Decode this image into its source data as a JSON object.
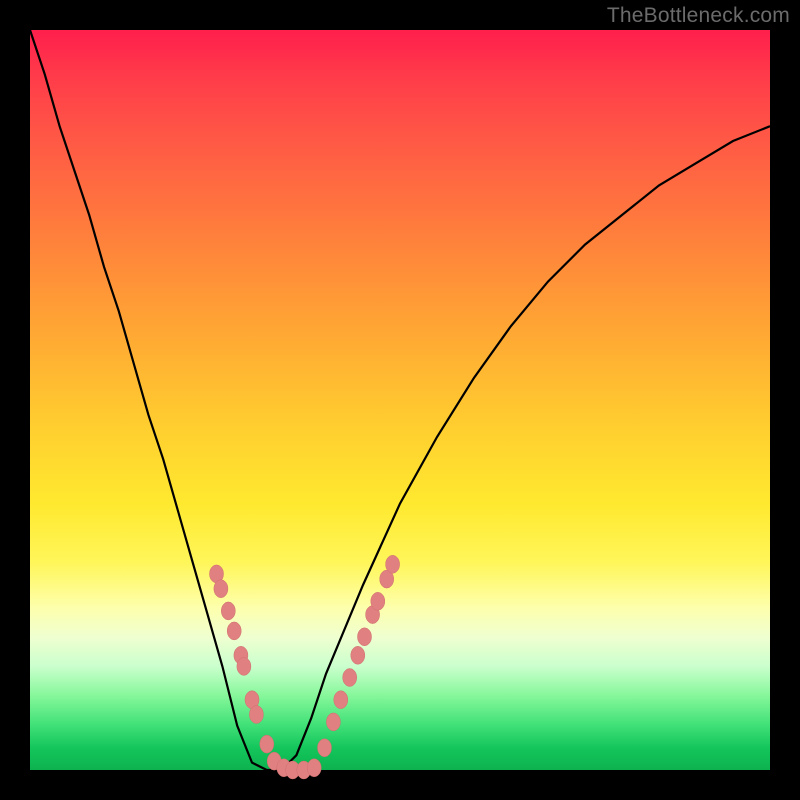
{
  "watermark_text": "TheBottleneck.com",
  "colors": {
    "frame": "#000000",
    "curve": "#000000",
    "marker_fill": "#e08080",
    "marker_stroke": "#d06f6f"
  },
  "chart_data": {
    "type": "line",
    "title": "",
    "xlabel": "",
    "ylabel": "",
    "x": [
      0.0,
      0.02,
      0.04,
      0.06,
      0.08,
      0.1,
      0.12,
      0.14,
      0.16,
      0.18,
      0.2,
      0.22,
      0.24,
      0.26,
      0.28,
      0.3,
      0.32,
      0.34,
      0.36,
      0.38,
      0.4,
      0.45,
      0.5,
      0.55,
      0.6,
      0.65,
      0.7,
      0.75,
      0.8,
      0.85,
      0.9,
      0.95,
      1.0
    ],
    "y": [
      1.0,
      0.94,
      0.87,
      0.81,
      0.75,
      0.68,
      0.62,
      0.55,
      0.48,
      0.42,
      0.35,
      0.28,
      0.21,
      0.14,
      0.06,
      0.01,
      0.0,
      0.0,
      0.02,
      0.07,
      0.13,
      0.25,
      0.36,
      0.45,
      0.53,
      0.6,
      0.66,
      0.71,
      0.75,
      0.79,
      0.82,
      0.85,
      0.87
    ],
    "xlim": [
      0,
      1
    ],
    "ylim": [
      0,
      1
    ],
    "annotations": [],
    "markers_left": [
      {
        "x": 0.252,
        "y": 0.265
      },
      {
        "x": 0.258,
        "y": 0.245
      },
      {
        "x": 0.268,
        "y": 0.215
      },
      {
        "x": 0.276,
        "y": 0.188
      },
      {
        "x": 0.285,
        "y": 0.155
      },
      {
        "x": 0.289,
        "y": 0.14
      },
      {
        "x": 0.3,
        "y": 0.095
      },
      {
        "x": 0.306,
        "y": 0.075
      },
      {
        "x": 0.32,
        "y": 0.035
      }
    ],
    "markers_bottom": [
      {
        "x": 0.33,
        "y": 0.012
      },
      {
        "x": 0.343,
        "y": 0.003
      },
      {
        "x": 0.355,
        "y": 0.0
      },
      {
        "x": 0.37,
        "y": 0.0
      },
      {
        "x": 0.384,
        "y": 0.003
      }
    ],
    "markers_right": [
      {
        "x": 0.398,
        "y": 0.03
      },
      {
        "x": 0.41,
        "y": 0.065
      },
      {
        "x": 0.42,
        "y": 0.095
      },
      {
        "x": 0.432,
        "y": 0.125
      },
      {
        "x": 0.443,
        "y": 0.155
      },
      {
        "x": 0.452,
        "y": 0.18
      },
      {
        "x": 0.463,
        "y": 0.21
      },
      {
        "x": 0.47,
        "y": 0.228
      },
      {
        "x": 0.482,
        "y": 0.258
      },
      {
        "x": 0.49,
        "y": 0.278
      }
    ]
  }
}
